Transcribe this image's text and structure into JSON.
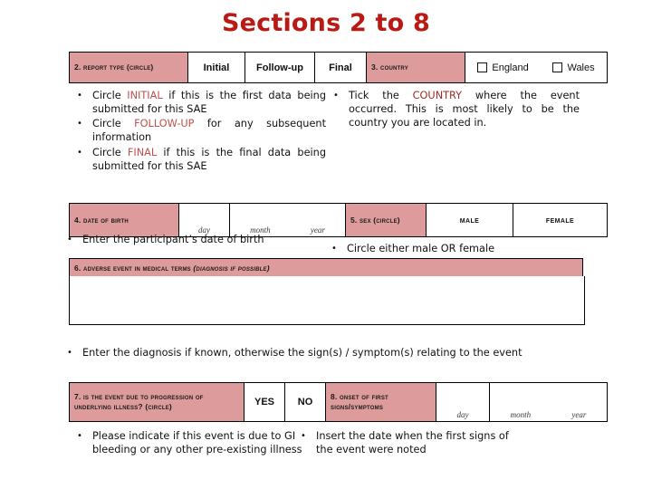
{
  "slide": {
    "title": "Sections 2 to 8"
  },
  "colors": {
    "title": "#B91B14",
    "header_fill": "#DE9B9B",
    "highlight": "#C0504D",
    "highlight_dark": "#9E2B26"
  },
  "form_row_1": {
    "report_type_label": "2. Report type (circle)",
    "options": [
      "Initial",
      "Follow-up",
      "Final"
    ],
    "country_label": "3. Country",
    "country_options": [
      "England",
      "Wales"
    ]
  },
  "bullets_1_left": [
    {
      "pre": "Circle ",
      "hl": "INITIAL",
      "post": " if this is the first data being submitted for this SAE"
    },
    {
      "pre": "Circle ",
      "hl": "FOLLOW-UP",
      "post": " for any subsequent information"
    },
    {
      "pre": "Circle ",
      "hl": "FINAL",
      "post": " if this is the final data being submitted for this SAE"
    }
  ],
  "bullets_1_right": [
    {
      "pre": "Tick the ",
      "hl": "COUNTRY",
      "post": " where the event occurred. This is most likely to be the country you are located in."
    }
  ],
  "form_row_2": {
    "dob_label": "4. Date of birth",
    "dob_day": "day",
    "dob_month": "month",
    "dob_year": "year",
    "sex_label": "5. Sex (circle)",
    "sex_options": [
      "Male",
      "Female"
    ]
  },
  "bullets_2_left": [
    {
      "text": "Enter the participant’s date of birth"
    }
  ],
  "bullets_2_right": [
    {
      "text": "Circle either male OR female"
    }
  ],
  "form_row_3": {
    "label_main": "6. Adverse event in medical terms ",
    "label_italic": "(diagnosis if possible)",
    "answer_value": ""
  },
  "bullets_3": [
    {
      "text": "Enter the diagnosis if known, otherwise the sign(s) / symptom(s) relating to the event"
    }
  ],
  "form_row_4": {
    "progression_label": "7. Is the event due to progression of underlying illness? (circle)",
    "progression_options": [
      "YES",
      "NO"
    ],
    "onset_label": "8. Onset of first signs/symptoms",
    "onset_day": "day",
    "onset_month": "month",
    "onset_year": "year"
  },
  "bullets_4_left": [
    {
      "text": "Please indicate if this event is due to GI bleeding or any other pre-existing illness"
    }
  ],
  "bullets_4_right": [
    {
      "text": "Insert the date when the first signs of the event were noted"
    }
  ]
}
